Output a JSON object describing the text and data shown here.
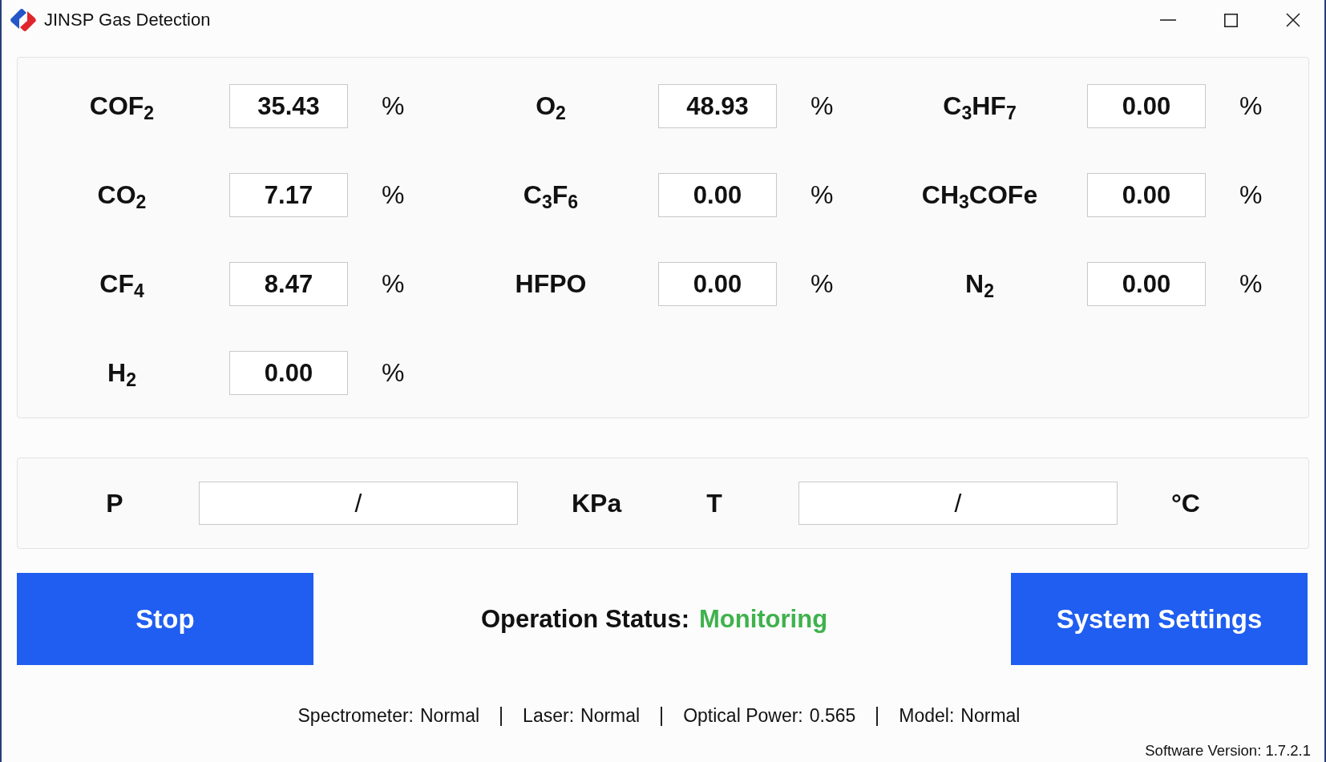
{
  "window": {
    "title": "JINSP Gas Detection"
  },
  "gases": [
    {
      "name": "COF$_{2}$",
      "value": "35.43",
      "unit": "%"
    },
    {
      "name": "O$_{2}$",
      "value": "48.93",
      "unit": "%"
    },
    {
      "name": "C$_{3}$HF$_{7}$",
      "value": "0.00",
      "unit": "%"
    },
    {
      "name": "CO$_{2}$",
      "value": "7.17",
      "unit": "%"
    },
    {
      "name": "C$_{3}$F$_{6}$",
      "value": "0.00",
      "unit": "%"
    },
    {
      "name": "CH$_{3}$COFe",
      "value": "0.00",
      "unit": "%"
    },
    {
      "name": "CF$_{4}$",
      "value": "8.47",
      "unit": "%"
    },
    {
      "name": "HFPO",
      "value": "0.00",
      "unit": "%"
    },
    {
      "name": "N$_{2}$",
      "value": "0.00",
      "unit": "%"
    },
    {
      "name": "H$_{2}$",
      "value": "0.00",
      "unit": "%"
    }
  ],
  "environment": [
    {
      "label": "P",
      "value": "/",
      "unit": "KPa"
    },
    {
      "label": "T",
      "value": "/",
      "unit": "°C"
    }
  ],
  "stop_button": {
    "label": "Stop"
  },
  "operation_status": {
    "label": "Operation Status:",
    "value": "Monitoring"
  },
  "settings_button": {
    "label": "System Settings"
  },
  "status_bar": {
    "items": [
      {
        "label": "Spectrometer:",
        "value": "Normal"
      },
      {
        "label": "Laser:",
        "value": "Normal"
      },
      {
        "label": "Optical Power:",
        "value": "0.565"
      },
      {
        "label": "Model:",
        "value": "Normal"
      }
    ],
    "version": "Software Version: 1.7.2.1"
  }
}
